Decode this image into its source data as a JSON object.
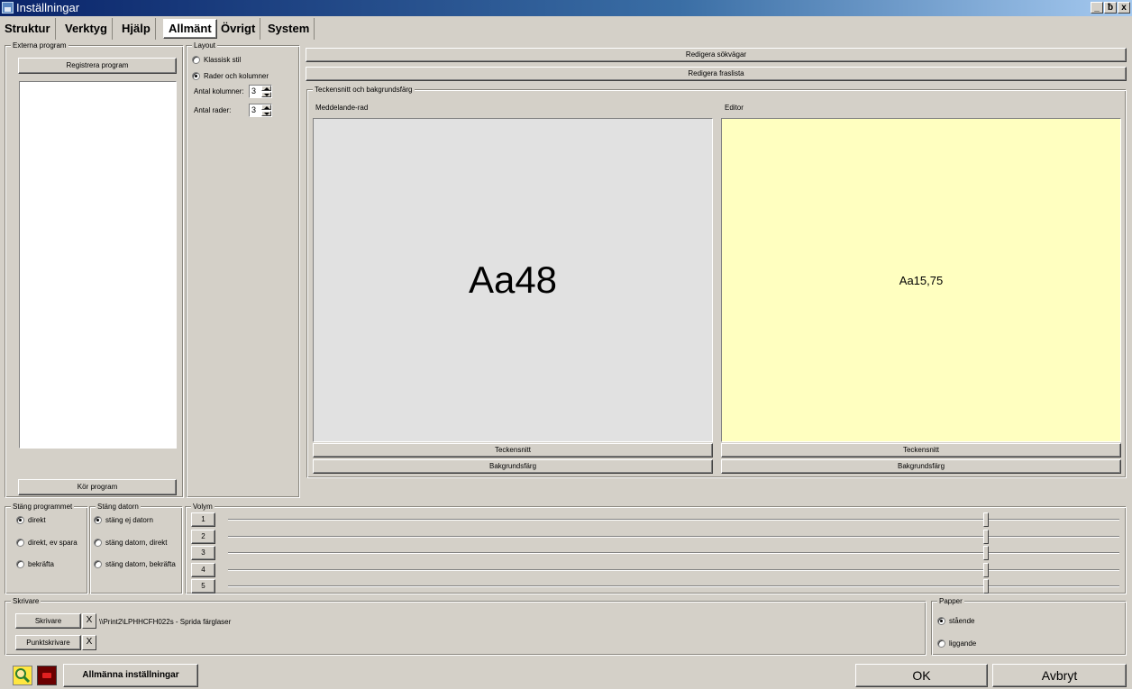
{
  "window": {
    "title": "Inställningar",
    "minimize": "_",
    "maximize": "ƀ",
    "close": "x"
  },
  "menu": {
    "tabs": [
      {
        "label": "Struktur"
      },
      {
        "label": "Verktyg"
      },
      {
        "label": "Hjälp"
      },
      {
        "label": "Allmänt"
      },
      {
        "label": "Övrigt"
      },
      {
        "label": "System"
      }
    ],
    "active": "Allmänt"
  },
  "external_programs": {
    "title": "Externa program",
    "register_button": "Registrera program",
    "run_button": "Kör program"
  },
  "layout": {
    "title": "Layout",
    "option_classic": "Klassisk stil",
    "option_rows_cols": "Rader och kolumner",
    "selected": "Rader och kolumner",
    "columns_label": "Antal kolumner:",
    "columns_value": "3",
    "rows_label": "Antal rader:",
    "rows_value": "3"
  },
  "edit_buttons": {
    "paths": "Redigera sökvägar",
    "phrases": "Redigera fraslista"
  },
  "font_bg": {
    "title": "Teckensnitt och bakgrundsfärg",
    "message_row": {
      "label": "Meddelande-rad",
      "sample": "Aa48",
      "bg_color": "#e1e1e1",
      "font_button": "Teckensnitt",
      "bg_button": "Bakgrundsfärg"
    },
    "editor": {
      "label": "Editor",
      "sample": "Aa15,75",
      "bg_color": "#ffffc0",
      "font_button": "Teckensnitt",
      "bg_button": "Bakgrundsfärg"
    }
  },
  "close_program": {
    "title": "Stäng programmet",
    "options": [
      "direkt",
      "direkt, ev spara",
      "bekräfta"
    ],
    "selected": "direkt"
  },
  "close_computer": {
    "title": "Stäng datorn",
    "options": [
      "stäng ej datorn",
      "stäng datorn, direkt",
      "stäng datorn, bekräfta"
    ],
    "selected": "stäng ej datorn"
  },
  "volume": {
    "title": "Volym",
    "channels": [
      {
        "label": "1",
        "level": 0.85
      },
      {
        "label": "2",
        "level": 0.85
      },
      {
        "label": "3",
        "level": 0.85
      },
      {
        "label": "4",
        "level": 0.85
      },
      {
        "label": "5",
        "level": 0.85
      }
    ]
  },
  "printers": {
    "title": "Skrivare",
    "printer_button": "Skrivare",
    "printer_clear": "X",
    "printer_value": "\\\\Print2\\LPHHCFH022s - Sprida färglaser",
    "dot_printer_button": "Punktskrivare",
    "dot_printer_clear": "X"
  },
  "paper": {
    "title": "Papper",
    "portrait": "stående",
    "landscape": "liggande",
    "selected": "stående"
  },
  "footer": {
    "general_settings": "Allmänna inställningar",
    "ok": "OK",
    "cancel": "Avbryt",
    "icon_search": "search-icon",
    "icon_rec": "record-icon"
  }
}
